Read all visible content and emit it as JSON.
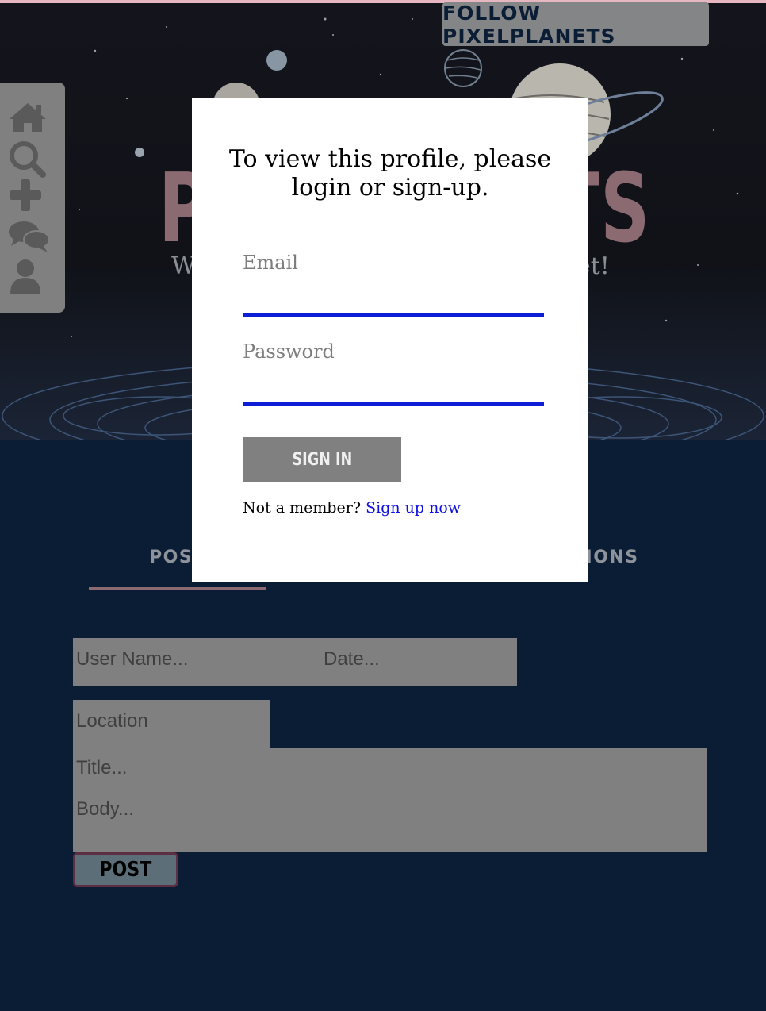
{
  "hero": {
    "title_left": "P",
    "title_right": "TS",
    "subtitle_left": "W",
    "subtitle_right": "et!"
  },
  "follow_button": {
    "label": "FOLLOW PIXELPLANETS"
  },
  "sidebar": {
    "items": [
      {
        "icon": "home-icon"
      },
      {
        "icon": "search-icon"
      },
      {
        "icon": "plus-icon"
      },
      {
        "icon": "chat-icon"
      },
      {
        "icon": "user-icon"
      }
    ]
  },
  "tabs": [
    {
      "label": "POST"
    },
    {
      "label": "TIONS"
    }
  ],
  "post_form": {
    "username_placeholder": "User Name...",
    "date_placeholder": "Date...",
    "location_placeholder": "Location",
    "title_placeholder": "Title...",
    "body_placeholder": "Body...",
    "post_label": "POST"
  },
  "modal": {
    "title_line1": "To view this profile, please",
    "title_line2": "login or sign-up.",
    "email_label": "Email",
    "password_label": "Password",
    "signin_label": "SIGN IN",
    "member_text": "Not a member?",
    "signup_link": "Sign up now"
  },
  "colors": {
    "page_bg": "#0b1d35",
    "accent_pink": "#8c6a72",
    "input_underline": "#0d1ed6",
    "link": "#1010e0"
  }
}
